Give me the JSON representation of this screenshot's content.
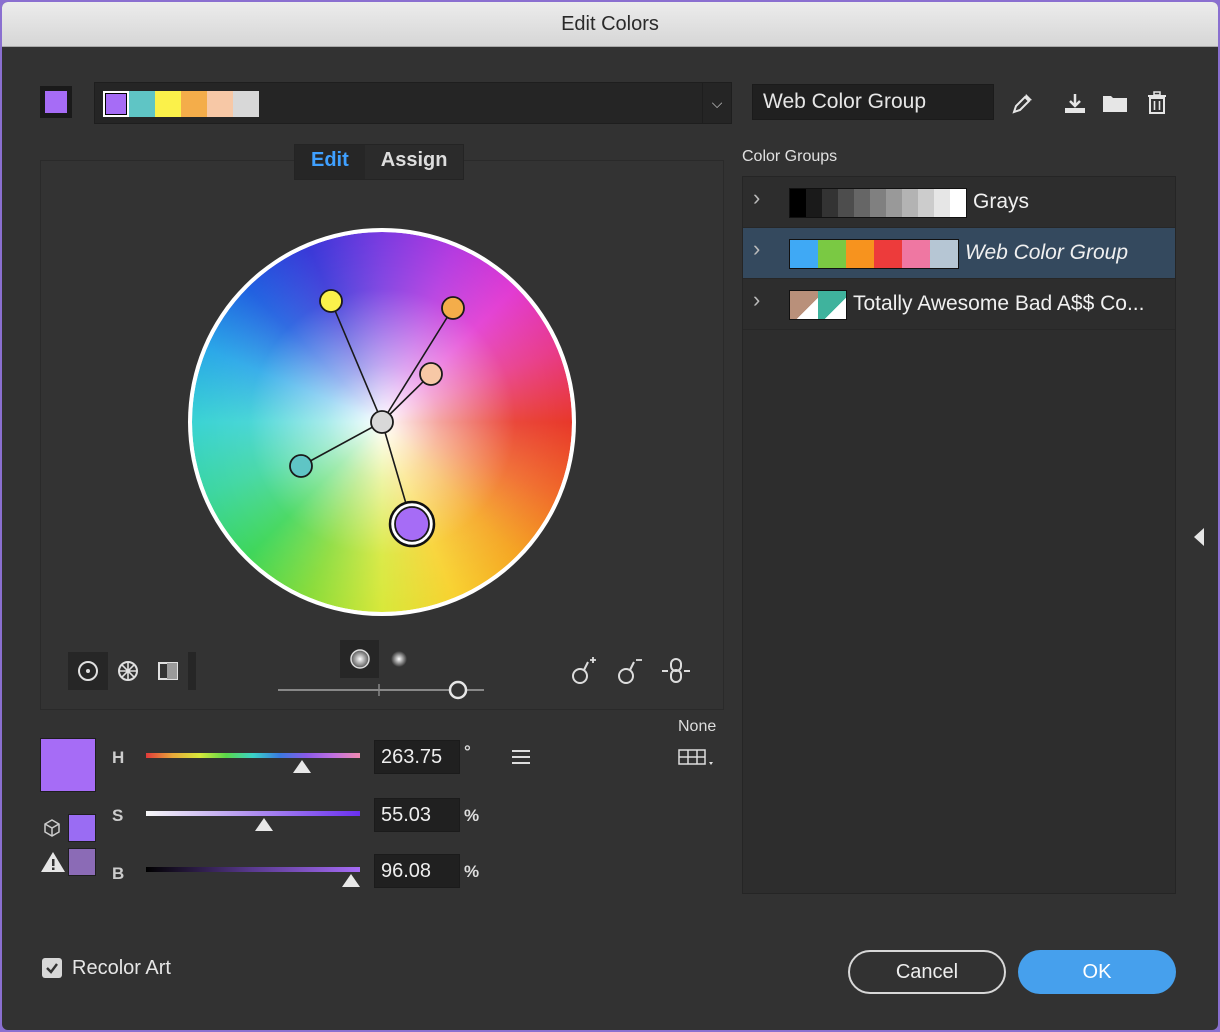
{
  "window": {
    "title": "Edit Colors"
  },
  "current_color": "#a66cf6",
  "active_group": {
    "swatches": [
      "#a66cf6",
      "#5fc5c5",
      "#fbf14a",
      "#f4ad4a",
      "#f7c8a6",
      "#d8d8d8"
    ],
    "dropdown_icon": "chevron-down-icon"
  },
  "group_name_field": {
    "value": "Web Color Group"
  },
  "toolbar_icons": [
    "eyedropper-icon",
    "save-group-icon",
    "new-folder-icon",
    "trash-icon"
  ],
  "tabs": [
    {
      "label": "Edit",
      "active": true
    },
    {
      "label": "Assign",
      "active": false
    }
  ],
  "wheel": {
    "markers": [
      {
        "color": "#fbf14a",
        "name": "yellow-marker"
      },
      {
        "color": "#f4ad4a",
        "name": "orange-marker"
      },
      {
        "color": "#f7c8a6",
        "name": "peach-marker"
      },
      {
        "color": "#5fc5c5",
        "name": "teal-marker"
      },
      {
        "color": "#a66cf6",
        "name": "purple-marker",
        "selected": true
      },
      {
        "color": "#d8d8d8",
        "name": "center-marker"
      }
    ]
  },
  "color_groups": {
    "label": "Color Groups",
    "items": [
      {
        "name": "Grays",
        "colors": [
          "#000000",
          "#1a1a1a",
          "#333333",
          "#4d4d4d",
          "#666666",
          "#808080",
          "#999999",
          "#b3b3b3",
          "#cccccc",
          "#e6e6e6",
          "#ffffff"
        ],
        "italic": false,
        "selected": false
      },
      {
        "name": "Web Color Group",
        "colors": [
          "#3fa9f5",
          "#7ac943",
          "#f7931e",
          "#ed3b3b",
          "#ef77a2",
          "#b6c6d4"
        ],
        "italic": true,
        "selected": true
      },
      {
        "name": "Totally Awesome Bad A$$ Co...",
        "colors": [
          "#b9907a",
          "#3fb39d"
        ],
        "italic": false,
        "selected": false
      }
    ]
  },
  "hsb": {
    "h": {
      "label": "H",
      "value": "263.75",
      "unit": "°",
      "fraction": 0.73
    },
    "s": {
      "label": "S",
      "value": "55.03",
      "unit": "%",
      "fraction": 0.55
    },
    "b": {
      "label": "B",
      "value": "96.08",
      "unit": "%",
      "fraction": 0.96
    }
  },
  "none_label": "None",
  "out_of_gamut_color": "#9a6cf3",
  "out_of_web_color": "#8b6bb6",
  "recolor_art": {
    "label": "Recolor Art",
    "checked": true
  },
  "buttons": {
    "cancel": "Cancel",
    "ok": "OK"
  },
  "colors": {
    "accent": "#3fa0ff",
    "ok_bg": "#46a0ed"
  }
}
